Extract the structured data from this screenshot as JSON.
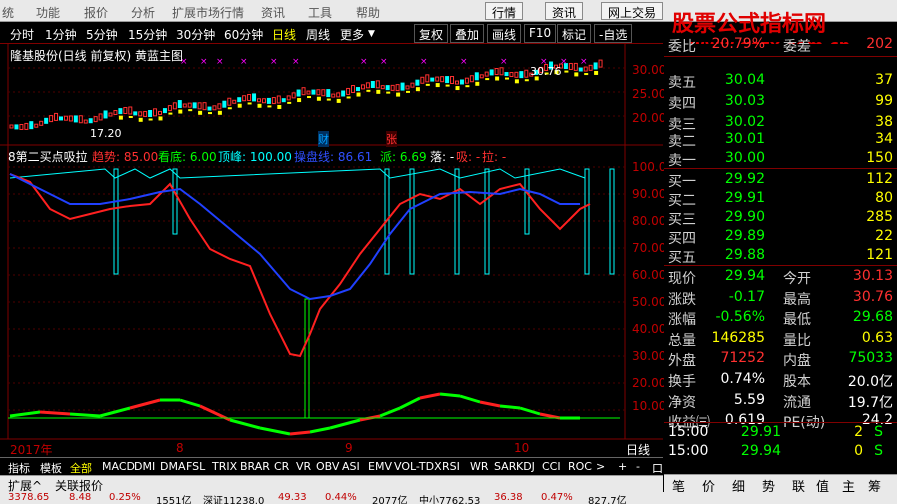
{
  "menu": {
    "items": [
      "统",
      "功能",
      "报价",
      "分析",
      "扩展市场行情",
      "资讯",
      "工具",
      "帮助"
    ],
    "right_buttons": [
      "行情",
      "资讯",
      "网上交易"
    ]
  },
  "watermark": {
    "line1": "股票公式指标网",
    "line2": "www.gszx.com.cn"
  },
  "periods": [
    "分时",
    "1分钟",
    "5分钟",
    "15分钟",
    "30分钟",
    "60分钟",
    "日线",
    "周线",
    "更多"
  ],
  "active_period": "日线",
  "tool_buttons": [
    "复权",
    "叠加",
    "画线",
    "F10",
    "标记",
    "-自选"
  ],
  "main_chart": {
    "title": "隆基股份(日线 前复权) 黄蓝主图",
    "high_label": "30.76",
    "low_label": "17.20",
    "marker_cai": "财",
    "marker_zhang": "张",
    "axis_ticks": [
      "30.00",
      "25.00",
      "20.00"
    ]
  },
  "indicator": {
    "name": "8第二买点吸拉",
    "values": [
      {
        "label": "趋势:",
        "value": "85.00",
        "color": "#ff3030"
      },
      {
        "label": "看底:",
        "value": "6.00",
        "color": "#00ff00"
      },
      {
        "label": "顶峰:",
        "value": "100.00",
        "color": "#00ffff"
      },
      {
        "label": "操盘线:",
        "value": "86.61",
        "color": "#3050ff"
      },
      {
        "label": "派:",
        "value": "6.69",
        "color": "#00ff00"
      },
      {
        "label": "落:",
        "value": "-",
        "color": "#ffffff"
      },
      {
        "label": "吸:",
        "value": "-",
        "color": "#ff3030"
      },
      {
        "label": "拉:",
        "value": "-",
        "color": "#ff3030"
      }
    ],
    "axis_ticks": [
      "100.00",
      "90.00",
      "80.00",
      "70.00",
      "60.00",
      "50.00",
      "40.00",
      "30.00",
      "20.00",
      "10.00"
    ]
  },
  "xaxis": {
    "labels": [
      "2017年",
      "8",
      "9",
      "10"
    ],
    "period": "日线"
  },
  "quote": {
    "partial_top": {
      "label": "委比",
      "value": "20.79%",
      "label2": "委差",
      "value2": "202"
    },
    "asks": [
      {
        "label": "卖五",
        "price": "30.04",
        "vol": "37"
      },
      {
        "label": "卖四",
        "price": "30.03",
        "vol": "99"
      },
      {
        "label": "卖三",
        "price": "30.02",
        "vol": "38"
      },
      {
        "label": "卖二",
        "price": "30.01",
        "vol": "34"
      },
      {
        "label": "卖一",
        "price": "30.00",
        "vol": "150"
      }
    ],
    "bids": [
      {
        "label": "买一",
        "price": "29.92",
        "vol": "112"
      },
      {
        "label": "买二",
        "price": "29.91",
        "vol": "80"
      },
      {
        "label": "买三",
        "price": "29.90",
        "vol": "285"
      },
      {
        "label": "买四",
        "price": "29.89",
        "vol": "22"
      },
      {
        "label": "买五",
        "price": "29.88",
        "vol": "121"
      }
    ],
    "stats": [
      {
        "l1": "现价",
        "v1": "29.94",
        "c1": "#00ff00",
        "l2": "今开",
        "v2": "30.13",
        "c2": "#ff3030"
      },
      {
        "l1": "涨跌",
        "v1": "-0.17",
        "c1": "#00ff00",
        "l2": "最高",
        "v2": "30.76",
        "c2": "#ff3030"
      },
      {
        "l1": "涨幅",
        "v1": "-0.56%",
        "c1": "#00ff00",
        "l2": "最低",
        "v2": "29.68",
        "c2": "#00ff00"
      },
      {
        "l1": "总量",
        "v1": "146285",
        "c1": "#ffff00",
        "l2": "量比",
        "v2": "0.63",
        "c2": "#ffff00"
      },
      {
        "l1": "外盘",
        "v1": "71252",
        "c1": "#ff3030",
        "l2": "内盘",
        "v2": "75033",
        "c2": "#00ff00"
      },
      {
        "l1": "换手",
        "v1": "0.74%",
        "c1": "#ffffff",
        "l2": "股本",
        "v2": "20.0亿",
        "c2": "#ffffff"
      },
      {
        "l1": "净资",
        "v1": "5.59",
        "c1": "#ffffff",
        "l2": "流通",
        "v2": "19.7亿",
        "c2": "#ffffff"
      },
      {
        "l1": "收益㈢",
        "v1": "0.619",
        "c1": "#ffffff",
        "l2": "PE(动)",
        "v2": "24.2",
        "c2": "#ffffff"
      }
    ],
    "ticks": [
      {
        "time": "15:00",
        "price": "29.91",
        "vol": "2",
        "side": "S"
      },
      {
        "time": "15:00",
        "price": "29.94",
        "vol": "0",
        "side": "S"
      }
    ],
    "bottom_tabs": [
      "笔",
      "价",
      "细",
      "势",
      "联",
      "值",
      "主",
      "筹"
    ]
  },
  "indicator_bar": [
    "指标",
    "模板",
    "全部",
    "MACD",
    "DMI",
    "DMA",
    "FSL",
    "TRIX",
    "BRAR",
    "CR",
    "VR",
    "OBV",
    "ASI",
    "EMV",
    "VOL-TDX",
    "RSI",
    "WR",
    "SAR",
    "KDJ",
    "CCI",
    "ROC",
    ">",
    "+",
    "-",
    "口"
  ],
  "ext_bar": [
    "扩展^",
    "关联报价"
  ],
  "ticker": [
    {
      "text": "3378.65",
      "color": "#c00000"
    },
    {
      "text": "8.48",
      "color": "#c00000"
    },
    {
      "text": "0.25%",
      "color": "#c00000"
    },
    {
      "text": "1551亿",
      "color": "#000000"
    },
    {
      "text": "深证11238.0",
      "color": "#000000"
    },
    {
      "text": "49.33",
      "color": "#c00000"
    },
    {
      "text": "0.44%",
      "color": "#c00000"
    },
    {
      "text": "2077亿",
      "color": "#000000"
    },
    {
      "text": "中小7762.53",
      "color": "#000000"
    },
    {
      "text": "36.38",
      "color": "#c00000"
    },
    {
      "text": "0.47%",
      "color": "#c00000"
    },
    {
      "text": "827.7亿",
      "color": "#000000"
    }
  ],
  "colors": {
    "up": "#ff3030",
    "down": "#00ff00",
    "grid": "#800000",
    "trend": "#ff2020",
    "line": "#2040ff",
    "bar": "#00ffff"
  }
}
